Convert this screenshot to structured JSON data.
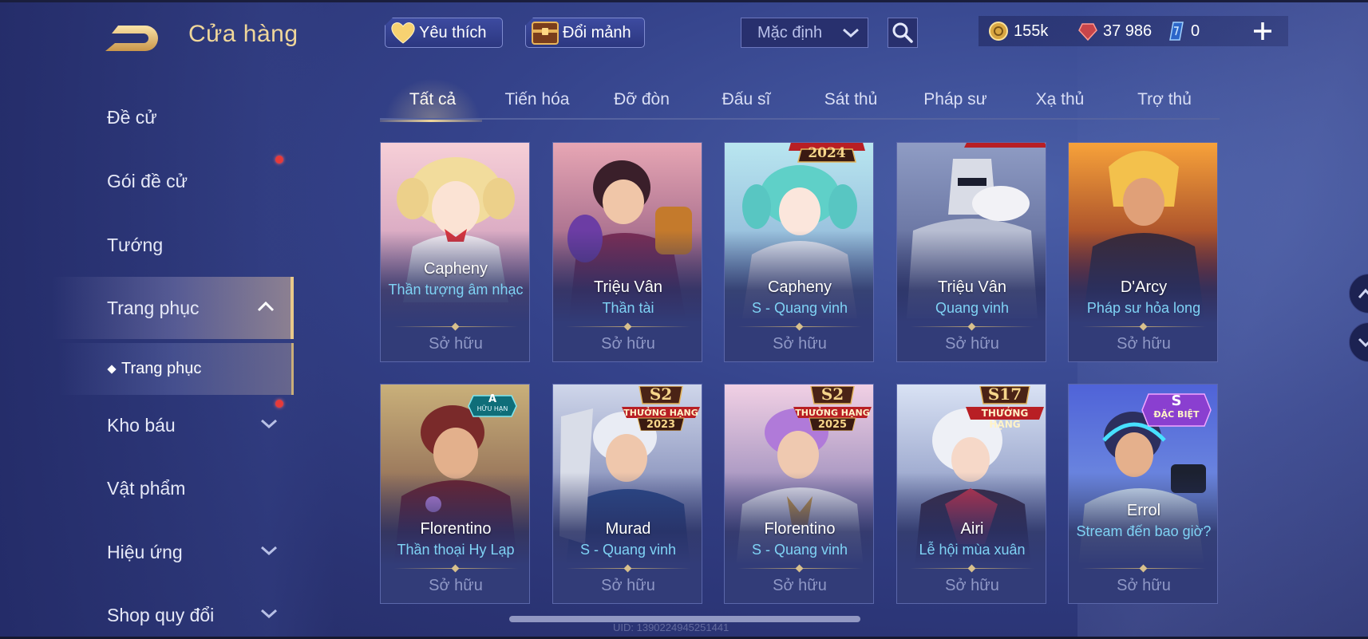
{
  "header": {
    "title": "Cửa hàng",
    "favorite_label": "Yêu thích",
    "exchange_label": "Đổi mảnh",
    "sort_value": "Mặc định",
    "currency": {
      "gold": "155k",
      "voucher": "37 986",
      "crystal": "0"
    }
  },
  "sidebar": {
    "items": [
      {
        "label": "Đề cử"
      },
      {
        "label": "Gói đề cử"
      },
      {
        "label": "Tướng"
      },
      {
        "label": "Trang phục"
      },
      {
        "label": "Kho báu"
      },
      {
        "label": "Vật phẩm"
      },
      {
        "label": "Hiệu ứng"
      },
      {
        "label": "Shop quy đổi"
      }
    ],
    "sub_item": "Trang phục"
  },
  "tabs": [
    "Tất cả",
    "Tiến hóa",
    "Đỡ đòn",
    "Đấu sĩ",
    "Sát thủ",
    "Pháp sư",
    "Xạ thủ",
    "Trợ thủ"
  ],
  "cards": [
    {
      "hero": "Capheny",
      "skin": "Thần tượng âm nhạc",
      "status": "Sở hữu"
    },
    {
      "hero": "Triệu Vân",
      "skin": "Thần tài",
      "status": "Sở hữu"
    },
    {
      "hero": "Capheny",
      "skin": "S - Quang vinh",
      "status": "Sở hữu",
      "badge": {
        "year": "2024"
      }
    },
    {
      "hero": "Triệu Vân",
      "skin": "Quang vinh",
      "status": "Sở hữu"
    },
    {
      "hero": "D'Arcy",
      "skin": "Pháp sư hỏa long",
      "status": "Sở hữu"
    },
    {
      "hero": "Florentino",
      "skin": "Thần thoại Hy Lạp",
      "status": "Sở hữu",
      "badge": {
        "title": "A",
        "sub": "HỮU HẠN"
      }
    },
    {
      "hero": "Murad",
      "skin": "S - Quang vinh",
      "status": "Sở hữu",
      "badge": {
        "title": "S2",
        "sub": "THƯỞNG HẠNG",
        "year": "2023"
      }
    },
    {
      "hero": "Florentino",
      "skin": "S - Quang vinh",
      "status": "Sở hữu",
      "badge": {
        "title": "S2",
        "sub": "THƯỞNG HẠNG",
        "year": "2025"
      }
    },
    {
      "hero": "Airi",
      "skin": "Lễ hội mùa xuân",
      "status": "Sở hữu",
      "badge": {
        "title": "S17",
        "sub": "THƯỞNG HẠNG"
      }
    },
    {
      "hero": "Errol",
      "skin": "Stream đến bao giờ?",
      "status": "Sở hữu",
      "badge": {
        "title": "S",
        "sub": "ĐẶC BIỆT"
      }
    }
  ],
  "footer": {
    "uid": "UID: 1390224945251441"
  },
  "colors": {
    "gold_accent": "#f0d79a",
    "skin_name": "#7fd3f5",
    "owned_text": "#8f98c6",
    "badge_red": "#b81f24"
  }
}
